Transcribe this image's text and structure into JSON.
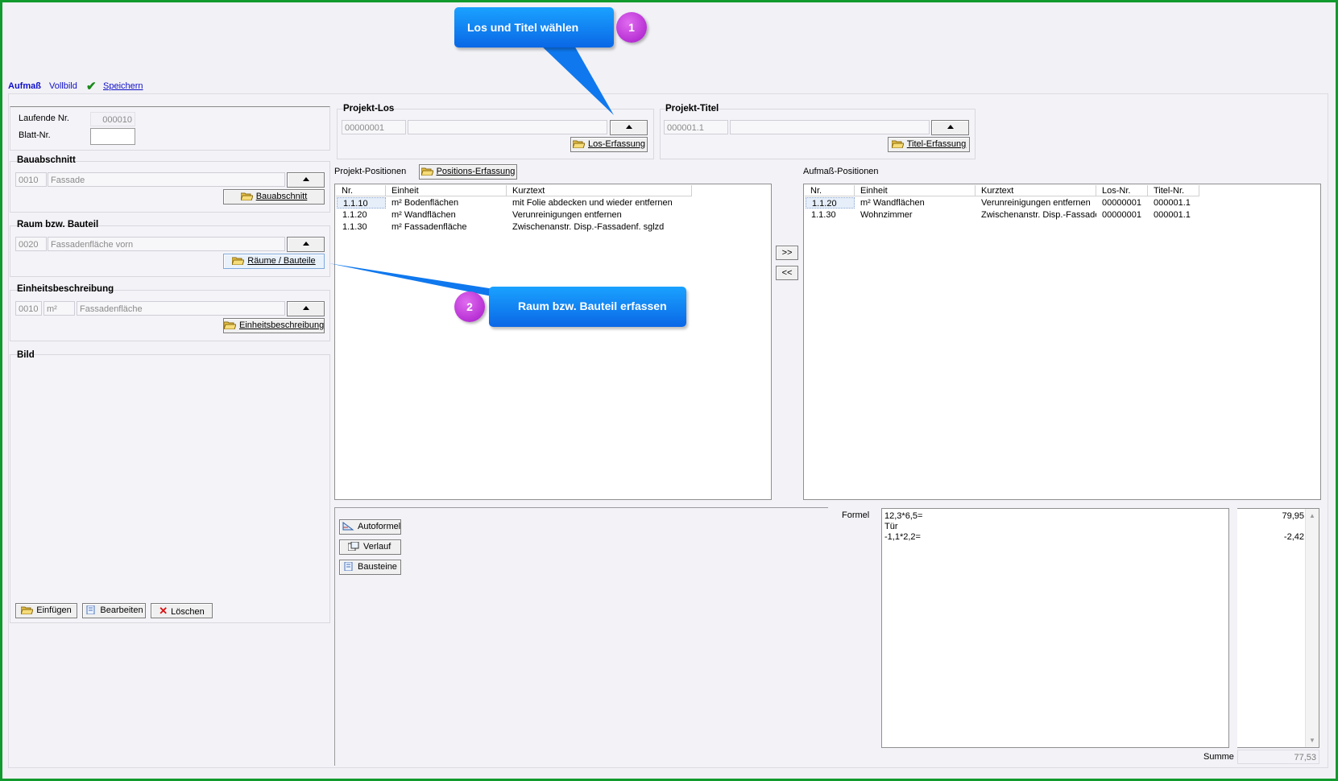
{
  "toolbar": {
    "tab_active": "Aufmaß",
    "fullscreen": "Vollbild",
    "save": "Speichern"
  },
  "header": {
    "laufende_label": "Laufende Nr.",
    "laufende_value": "000010",
    "blatt_label": "Blatt-Nr.",
    "blatt_value": ""
  },
  "bauabschnitt": {
    "title": "Bauabschnitt",
    "code": "0010",
    "name": "Fassade",
    "button": "Bauabschnitt"
  },
  "raum": {
    "title": "Raum bzw. Bauteil",
    "code": "0020",
    "name": "Fassadenfläche vorn",
    "button": "Räume / Bauteile"
  },
  "einheit": {
    "title": "Einheitsbeschreibung",
    "code": "0010",
    "unit": "m²",
    "name": "Fassadenfläche",
    "button": "Einheitsbeschreibung"
  },
  "bild": {
    "title": "Bild",
    "insert": "Einfügen",
    "edit": "Bearbeiten",
    "delete": "Löschen"
  },
  "los": {
    "title": "Projekt-Los",
    "code": "00000001",
    "name": "",
    "button": "Los-Erfassung"
  },
  "titel": {
    "title": "Projekt-Titel",
    "code": "000001.1",
    "name": "",
    "button": "Titel-Erfassung"
  },
  "projekt_positionen": {
    "label": "Projekt-Positionen",
    "button": "Positions-Erfassung",
    "columns": [
      "Nr.",
      "Einheit",
      "Kurztext"
    ],
    "rows": [
      [
        "1.1.10",
        "m² Bodenflächen",
        "mit Folie abdecken und wieder entfernen"
      ],
      [
        "1.1.20",
        "m² Wandflächen",
        "Verunreinigungen entfernen"
      ],
      [
        "1.1.30",
        "m² Fassadenfläche",
        "Zwischenanstr. Disp.-Fassadenf. sglzd"
      ]
    ]
  },
  "transfer": {
    "add": ">>",
    "remove": "<<"
  },
  "aufmass_positionen": {
    "label": "Aufmaß-Positionen",
    "columns": [
      "Nr.",
      "Einheit",
      "Kurztext",
      "Los-Nr.",
      "Titel-Nr."
    ],
    "rows": [
      [
        "1.1.20",
        "m² Wandflächen",
        "Verunreinigungen entfernen",
        "00000001",
        "000001.1"
      ],
      [
        "1.1.30",
        "Wohnzimmer",
        "Zwischenanstr. Disp.-Fassader",
        "00000001",
        "000001.1"
      ]
    ]
  },
  "tools": {
    "autoformel": "Autoformel",
    "verlauf": "Verlauf",
    "bausteine": "Bausteine"
  },
  "formel": {
    "label": "Formel",
    "lines": [
      "12,3*6,5=",
      "Tür",
      "-1,1*2,2="
    ],
    "results": [
      "79,95",
      "",
      "-2,42"
    ],
    "sum_label": "Summe",
    "sum_value": "77,53"
  },
  "callouts": {
    "c1_text": "Los und Titel wählen",
    "c1_num": "1",
    "c2_text": "Raum bzw. Bauteil erfassen",
    "c2_num": "2"
  },
  "colors": {
    "frame": "#119a2d",
    "callout": "#0a84f0",
    "badge": "#b62ad6"
  }
}
